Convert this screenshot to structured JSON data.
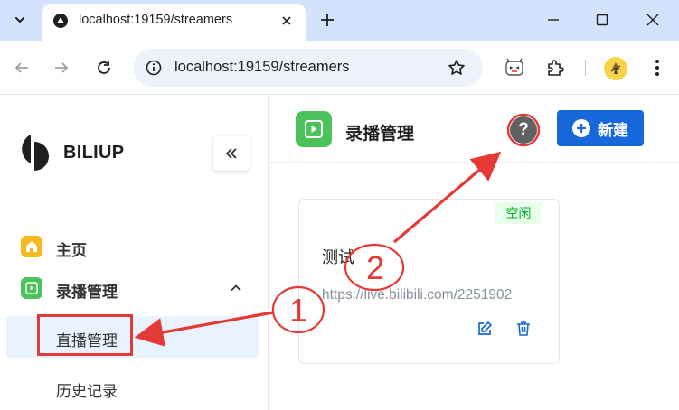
{
  "browser": {
    "tab_title": "localhost:19159/streamers",
    "url": "localhost:19159/streamers"
  },
  "sidebar": {
    "brand": "BILIUP",
    "items": [
      {
        "label": "主页",
        "icon": "home-icon",
        "color": "#f7ba1e"
      },
      {
        "label": "录播管理",
        "icon": "video-icon",
        "color": "#4cc25b"
      }
    ],
    "sub_items": [
      {
        "label": "直播管理",
        "active": true
      },
      {
        "label": "历史记录",
        "active": false
      }
    ]
  },
  "header": {
    "title": "录播管理",
    "new_label": "新建"
  },
  "card": {
    "status": "空闲",
    "name": "测试",
    "url": "https://live.bilibili.com/2251902"
  },
  "annotations": {
    "label_1": "1",
    "label_2": "2"
  },
  "colors": {
    "accent": "#1668dc",
    "annotation": "#e53935",
    "status_bg": "#e8ffea",
    "status_text": "#00b42a"
  }
}
